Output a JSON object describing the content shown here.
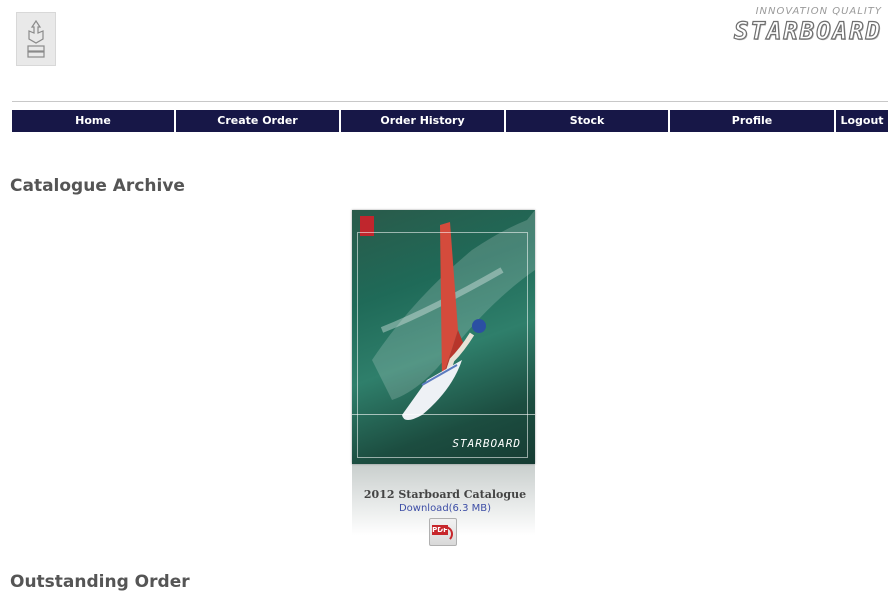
{
  "header": {
    "brand_tagline": "INNOVATION QUALITY",
    "brand_name": "STARBOARD",
    "accent_color": "#171747"
  },
  "nav": {
    "items": [
      {
        "label": "Home"
      },
      {
        "label": "Create Order"
      },
      {
        "label": "Order History"
      },
      {
        "label": "Stock"
      },
      {
        "label": "Profile"
      },
      {
        "label": "Logout"
      }
    ]
  },
  "catalogue_section": {
    "title": "Catalogue Archive",
    "item": {
      "cover_brand": "STARBOARD",
      "name": "2012 Starboard Catalogue",
      "download_label": "Download(6.3 MB)",
      "file_icon": "pdf-icon",
      "file_icon_text": "PDF"
    }
  },
  "outstanding_section": {
    "title": "Outstanding Order"
  }
}
